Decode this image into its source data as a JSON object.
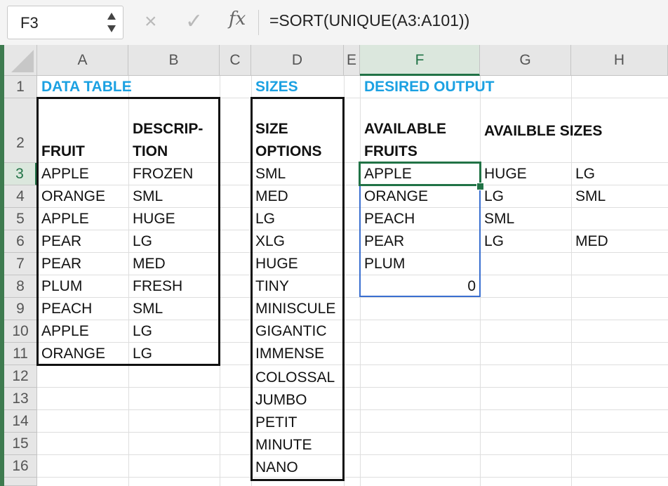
{
  "formula_bar": {
    "name_box": "F3",
    "cancel_icon": "×",
    "enter_icon": "✓",
    "fx_label": "fx",
    "formula": "=SORT(UNIQUE(A3:A101))"
  },
  "columns": [
    "A",
    "B",
    "C",
    "D",
    "E",
    "F",
    "G",
    "H"
  ],
  "rows": [
    "1",
    "2",
    "3",
    "4",
    "5",
    "6",
    "7",
    "8",
    "9",
    "10",
    "11",
    "12",
    "13",
    "14",
    "15",
    "16"
  ],
  "headings": {
    "data_table": "DATA TABLE",
    "sizes": "SIZES",
    "desired_output": "DESIRED OUTPUT",
    "fruit": "FRUIT",
    "description_1": "DESCRIP-",
    "description_2": "TION",
    "size_options_1": "SIZE",
    "size_options_2": "OPTIONS",
    "available_fruits_1": "AVAILABLE",
    "available_fruits_2": "FRUITS",
    "available_sizes": "AVAILBLE SIZES"
  },
  "data_table": [
    {
      "fruit": "APPLE",
      "desc": "FROZEN"
    },
    {
      "fruit": "ORANGE",
      "desc": "SML"
    },
    {
      "fruit": "APPLE",
      "desc": "HUGE"
    },
    {
      "fruit": "PEAR",
      "desc": "LG"
    },
    {
      "fruit": "PEAR",
      "desc": "MED"
    },
    {
      "fruit": "PLUM",
      "desc": "FRESH"
    },
    {
      "fruit": "PEACH",
      "desc": "SML"
    },
    {
      "fruit": "APPLE",
      "desc": "LG"
    },
    {
      "fruit": "ORANGE",
      "desc": "LG"
    }
  ],
  "sizes": [
    "SML",
    "MED",
    "LG",
    "XLG",
    "HUGE",
    "TINY",
    "MINISCULE",
    "GIGANTIC",
    "IMMENSE",
    "COLOSSAL",
    "JUMBO",
    "PETIT",
    "MINUTE",
    "NANO"
  ],
  "output": {
    "fruits": [
      "APPLE",
      "ORANGE",
      "PEACH",
      "PEAR",
      "PLUM",
      "0"
    ],
    "sizes_g": [
      "HUGE",
      "LG",
      "SML",
      "LG"
    ],
    "sizes_h": [
      "LG",
      "SML",
      "",
      "MED"
    ]
  }
}
